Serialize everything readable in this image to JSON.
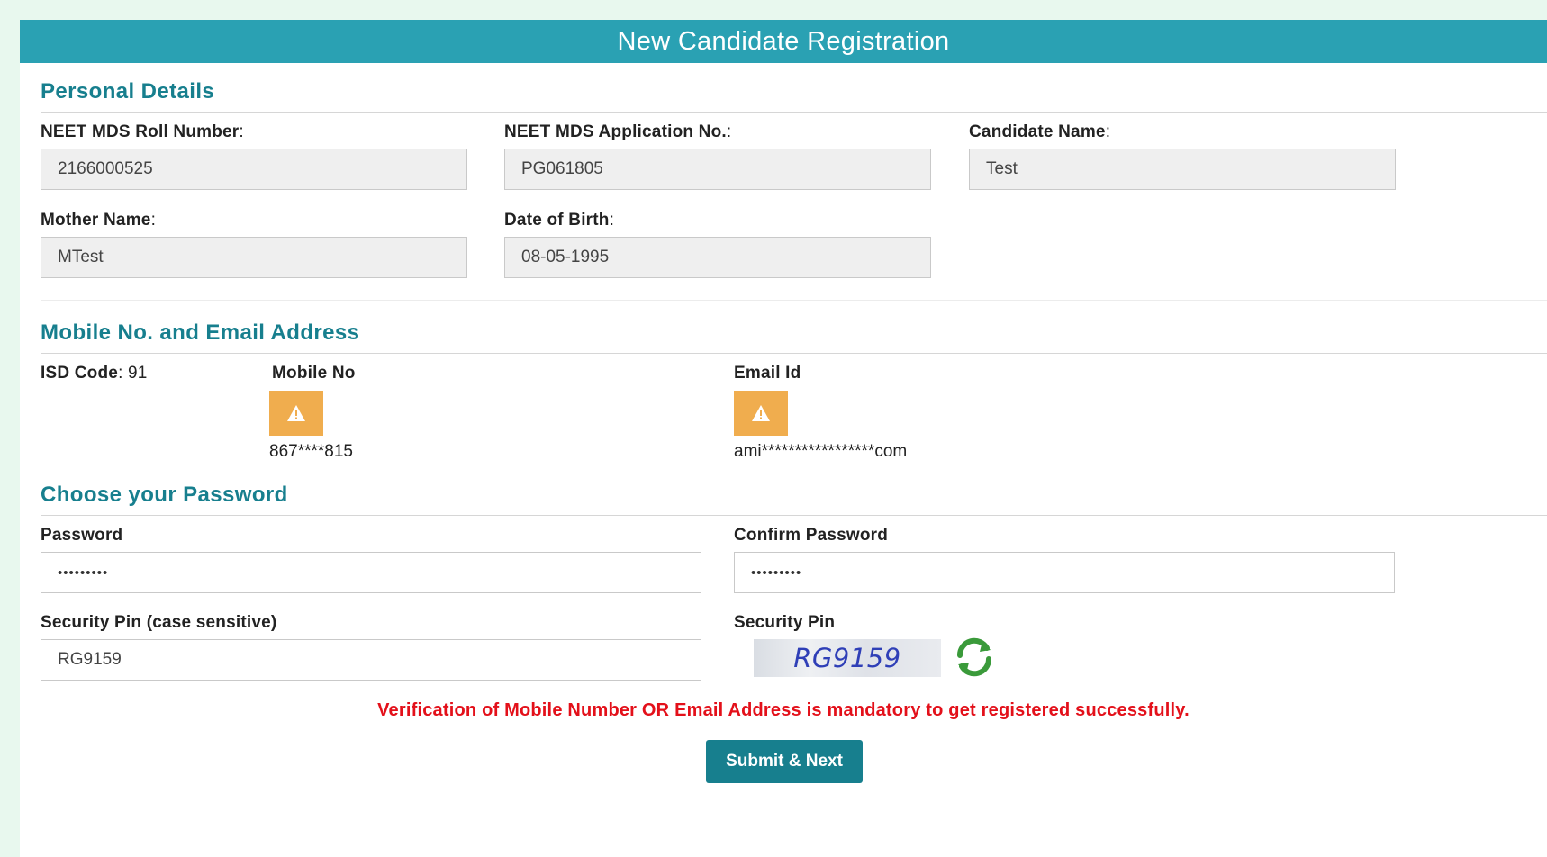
{
  "form": {
    "title": "New Candidate Registration"
  },
  "personal": {
    "heading": "Personal Details",
    "roll_label": "NEET MDS Roll Number",
    "roll_value": "2166000525",
    "application_label": "NEET MDS Application No.",
    "application_value": "PG061805",
    "candidate_label": "Candidate Name",
    "candidate_value": "Test",
    "mother_label": "Mother Name",
    "mother_value": "MTest",
    "dob_label": "Date of Birth",
    "dob_value": "08-05-1995",
    "colon": ":"
  },
  "contact": {
    "heading": "Mobile No. and Email Address",
    "isd_label": "ISD Code",
    "isd_value": ": 91",
    "mobile_label": "Mobile No",
    "mobile_masked": "867****815",
    "email_label": "Email Id",
    "email_masked": "ami*****************com",
    "warning_icon": "warning-triangle-icon",
    "warning_color": "#f0ad4e"
  },
  "password": {
    "heading": "Choose your Password",
    "password_label": "Password",
    "password_value": "•••••••••",
    "confirm_label": "Confirm Password",
    "confirm_value": "•••••••••",
    "pin_input_label": "Security Pin (case sensitive)",
    "pin_input_value": "RG9159",
    "pin_label": "Security Pin",
    "captcha_text": "RG9159",
    "refresh_icon": "refresh-icon"
  },
  "notice": "Verification of Mobile Number OR Email Address is mandatory to get registered successfully.",
  "submit_label": "Submit & Next",
  "colors": {
    "header": "#2aa1b3",
    "heading": "#177f8e",
    "notice": "#e3101a",
    "button": "#177f8e"
  }
}
